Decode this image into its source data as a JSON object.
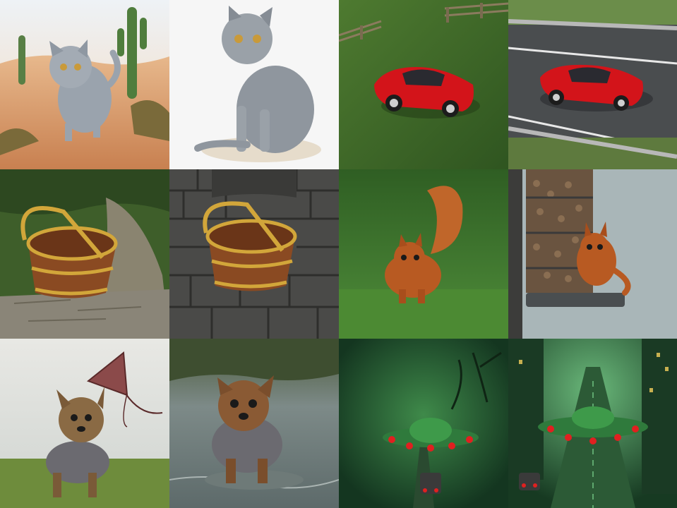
{
  "grid": {
    "rows": 3,
    "columns": 4
  },
  "tiles": [
    {
      "subject": "gray-cat",
      "scene": "desert",
      "palette": [
        "#e8b98a",
        "#9aa3ad",
        "#3f7a3a"
      ]
    },
    {
      "subject": "gray-cat",
      "scene": "white-studio",
      "palette": [
        "#f4f4f4",
        "#8f969e",
        "#e4dbcb"
      ]
    },
    {
      "subject": "red-sports-car",
      "scene": "grass-field",
      "palette": [
        "#3d6a2a",
        "#d3141a",
        "#8b7b5e"
      ]
    },
    {
      "subject": "red-sports-car",
      "scene": "highway",
      "palette": [
        "#4a4d4f",
        "#d3141a",
        "#6b8d4a"
      ]
    },
    {
      "subject": "wooden-bucket",
      "scene": "garden-stone-path",
      "palette": [
        "#3e5e2a",
        "#8a4a22",
        "#d2a63a"
      ]
    },
    {
      "subject": "wooden-bucket",
      "scene": "stone-wall",
      "palette": [
        "#4a4a48",
        "#8a4a22",
        "#d2a63a"
      ]
    },
    {
      "subject": "red-squirrel",
      "scene": "lawn",
      "palette": [
        "#4f8d3a",
        "#b85a22",
        "#2f5e23"
      ]
    },
    {
      "subject": "red-squirrel",
      "scene": "bird-feeder",
      "palette": [
        "#a9b6b8",
        "#b85a22",
        "#5c4a3a"
      ]
    },
    {
      "subject": "yorkshire-terrier",
      "scene": "meadow-with-kite",
      "palette": [
        "#dcdcd8",
        "#6b4a2e",
        "#6e8c3c"
      ]
    },
    {
      "subject": "yorkshire-terrier",
      "scene": "stream",
      "palette": [
        "#7d8a88",
        "#8a5a34",
        "#4a5a3a"
      ]
    },
    {
      "subject": "flying-saucer",
      "scene": "green-forest-road",
      "palette": [
        "#1f4a2e",
        "#2f7a3c",
        "#e02020"
      ]
    },
    {
      "subject": "flying-saucer",
      "scene": "green-city-street",
      "palette": [
        "#1f4a2e",
        "#2f7a3c",
        "#e02020"
      ]
    }
  ]
}
